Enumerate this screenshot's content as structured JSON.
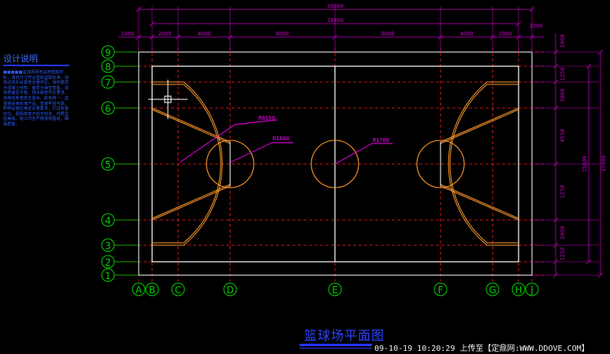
{
  "drawing": {
    "title": "篮球场平面图",
    "upload_stamp": "09-10-19  10:20:29 上传至【定鼎网:WWW.DDOVE.COM】"
  },
  "notes": {
    "title": "设计说明",
    "body": "■■■■■篮球场场地采用塑胶材料，场地尺寸符合国际篮联标准，球场边线外设置安全缓冲区。场地基层为混凝土结构，面层为弹性塑胶。球场表面应平整，排水坡度符合要求。场地线条宽度五厘米，颜色统一。篮球架采用标准产品，安装牢固可靠。照明设施应满足比赛要求，灯具布置均匀。围网高度不低于四米，材质坚固美观。施工时应严格按照图纸，确保质量。"
  },
  "dimensions": {
    "top_overall": "30000",
    "top_inner": "28000",
    "top_segments": [
      "1000",
      "2000",
      "4000",
      "8000",
      "8000",
      "4000",
      "2000",
      "1000"
    ],
    "right_segments": [
      "1000",
      "1250",
      "3000",
      "4550",
      "1250",
      "2000",
      "1250"
    ],
    "right_total_inner": "15000",
    "right_total_outer": "17000"
  },
  "grid": {
    "columns": [
      "A",
      "B",
      "C",
      "D",
      "E",
      "F",
      "G",
      "H",
      "J"
    ],
    "rows": [
      "9",
      "8",
      "7",
      "6",
      "5",
      "4",
      "3",
      "2",
      "1"
    ]
  },
  "radius_labels": {
    "three_point": "R6150",
    "free_throw": "R1800",
    "center_circle": "R1700"
  },
  "colors": {
    "background": "#000000",
    "dimension": "#c000c0",
    "grid_line": "#ff2020",
    "axis_bubble": "#00d000",
    "court_line": "#ffffff",
    "arc": "#ff9a2a",
    "leader": "#ff00ff",
    "notes_text": "#2f5cff"
  }
}
